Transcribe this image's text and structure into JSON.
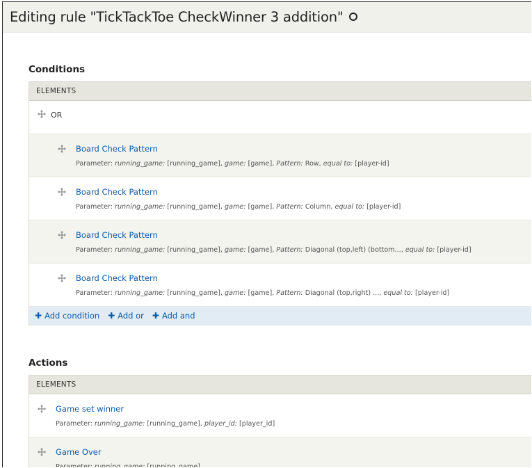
{
  "page": {
    "title": "Editing rule \"TickTackToe CheckWinner 3 addition\"",
    "title_icon": "settings-dot-icon"
  },
  "conditions": {
    "heading": "Conditions",
    "table_header": "ELEMENTS",
    "or_label": "OR",
    "items": [
      {
        "label": "Board Check Pattern",
        "prefix": "Parameter: ",
        "params": [
          {
            "key": "running_game:",
            "val": " [running_game], "
          },
          {
            "key": "game:",
            "val": " [game], "
          },
          {
            "key": "Pattern:",
            "val": " Row, "
          },
          {
            "key": "equal to:",
            "val": " [player-id]"
          }
        ]
      },
      {
        "label": "Board Check Pattern",
        "prefix": "Parameter: ",
        "params": [
          {
            "key": "running_game:",
            "val": " [running_game], "
          },
          {
            "key": "game:",
            "val": " [game], "
          },
          {
            "key": "Pattern:",
            "val": " Column, "
          },
          {
            "key": "equal to:",
            "val": " [player-id]"
          }
        ]
      },
      {
        "label": "Board Check Pattern",
        "prefix": "Parameter: ",
        "params": [
          {
            "key": "running_game:",
            "val": " [running_game], "
          },
          {
            "key": "game:",
            "val": " [game], "
          },
          {
            "key": "Pattern:",
            "val": " Diagonal (top,left) (bottom..., "
          },
          {
            "key": "equal to:",
            "val": " [player-id]"
          }
        ]
      },
      {
        "label": "Board Check Pattern",
        "prefix": "Parameter: ",
        "params": [
          {
            "key": "running_game:",
            "val": " [running_game], "
          },
          {
            "key": "game:",
            "val": " [game], "
          },
          {
            "key": "Pattern:",
            "val": " Diagonal (top,right) ..., "
          },
          {
            "key": "equal to:",
            "val": " [player-id]"
          }
        ]
      }
    ],
    "add_links": {
      "add_condition": "Add condition",
      "add_or": "Add or",
      "add_and": "Add and"
    }
  },
  "actions": {
    "heading": "Actions",
    "table_header": "ELEMENTS",
    "items": [
      {
        "label": "Game set winner",
        "prefix": "Parameter: ",
        "params": [
          {
            "key": "running_game:",
            "val": " [running_game], "
          },
          {
            "key": "player_id:",
            "val": " [player_id]"
          }
        ]
      },
      {
        "label": "Game Over",
        "prefix": "Parameter: ",
        "params": [
          {
            "key": "running_game:",
            "val": " [running_game]"
          }
        ]
      }
    ]
  },
  "colors": {
    "link": "#0b5aa8",
    "header_bg": "#f1f1ec",
    "table_head_bg": "#e6e6df",
    "row_tint": "#f4f4ee",
    "add_bar_bg": "#e1ecf5"
  }
}
